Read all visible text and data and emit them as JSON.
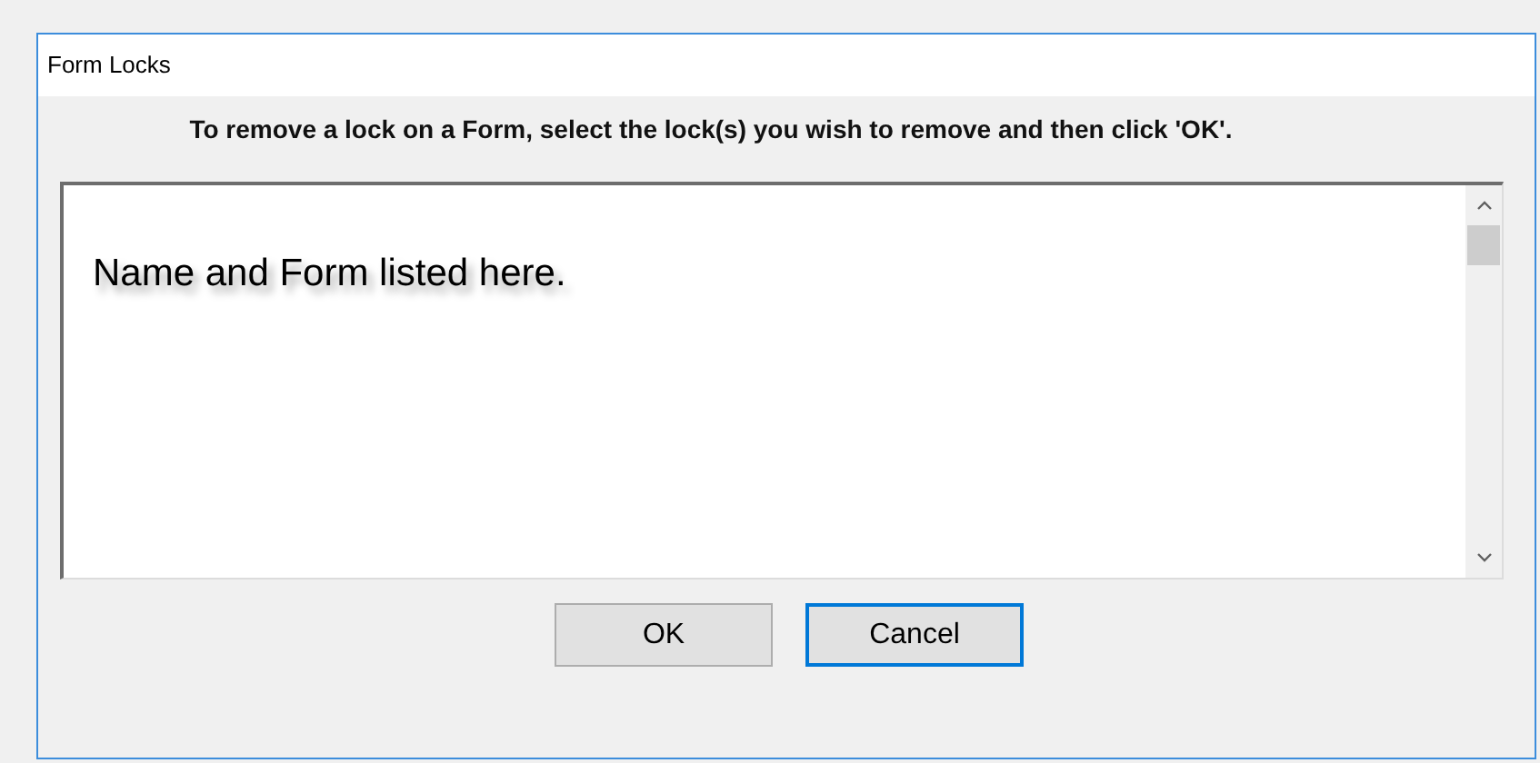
{
  "window": {
    "title": "Form Locks"
  },
  "instruction": "To remove a lock on a Form, select the lock(s) you wish to remove and then click 'OK'.",
  "list": {
    "items": [
      "Name and Form listed here."
    ]
  },
  "buttons": [
    {
      "label": "OK",
      "focused": false
    },
    {
      "label": "Cancel",
      "focused": true
    }
  ]
}
